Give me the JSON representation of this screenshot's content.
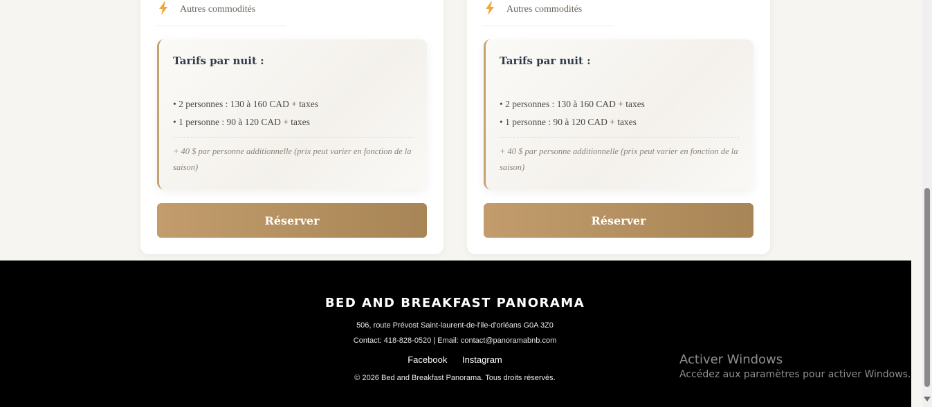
{
  "cards": [
    {
      "amenity_label": "Autres commodités",
      "rates": {
        "title": "Tarifs par nuit :",
        "line1": "• 2 personnes : 130 à 160 CAD + taxes",
        "line2": "• 1 personne : 90 à 120 CAD + taxes",
        "note": "+ 40 $ par personne additionnelle (prix peut varier en fonction de la saison)"
      },
      "reserve_label": "Réserver"
    },
    {
      "amenity_label": "Autres commodités",
      "rates": {
        "title": "Tarifs par nuit :",
        "line1": "• 2 personnes : 130 à 160 CAD + taxes",
        "line2": "• 1 personne : 90 à 120 CAD + taxes",
        "note": "+ 40 $ par personne additionnelle (prix peut varier en fonction de la saison)"
      },
      "reserve_label": "Réserver"
    }
  ],
  "footer": {
    "brand": "BED AND BREAKFAST PANORAMA",
    "address": "506, route Prévost Saint-laurent-de-l'ile-d'orléans G0A 3Z0",
    "contact": "Contact: 418-828-0520 | Email: contact@panoramabnb.com",
    "social": [
      "Facebook",
      "Instagram"
    ],
    "copyright": "© 2026 Bed and Breakfast Panorama. Tous droits réservés."
  },
  "windows_activation": {
    "title": "Activer Windows",
    "subtitle": "Accédez aux paramètres pour activer Windows."
  },
  "icons": {
    "amenity": "lightning-icon"
  },
  "colors": {
    "accent": "#c29c6c",
    "footer_bg": "#000000",
    "bolt": "#f0a63a"
  }
}
